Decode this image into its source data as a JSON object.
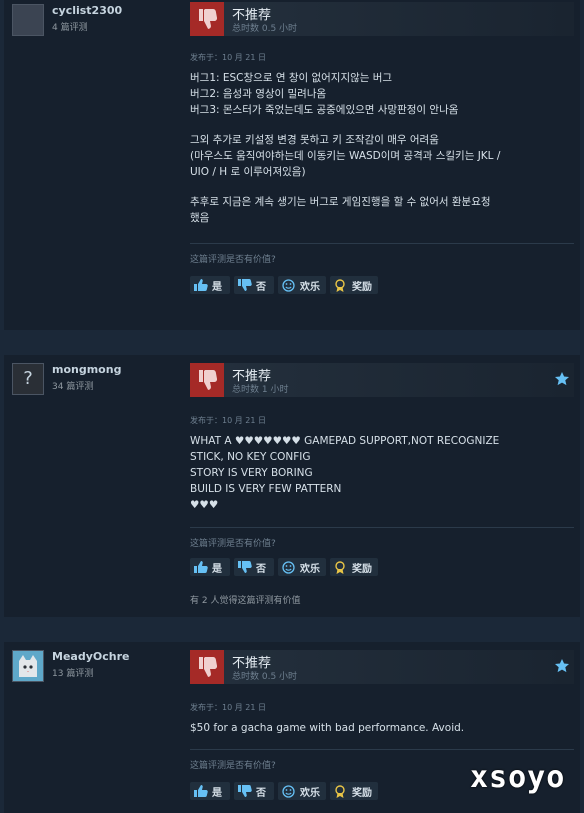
{
  "reviews": [
    {
      "author_name": "cyclist2300",
      "author_reviews": "4 篇评测",
      "avatar_icon": "user-avatar",
      "verdict": "不推荐",
      "hours": "总时数 0.5 小时",
      "posted": "发布于：10 月 21 日",
      "lines": [
        "버그1: ESC창으로 연 창이 없어지지않는 버그",
        "버그2: 음성과 영상이 밀려나옴",
        "버그3: 몬스터가 죽었는데도 공중에있으면 사망판정이 안나옴",
        "",
        "그외 추가로 키설정 변경 못하고 키 조작감이 매우 어려움",
        "(마우스도 움직여야하는데 이동키는 WASD이며 공격과 스킬키는 JKL /",
        "UIO / H 로 이루어져있음)",
        "",
        "추후로 지금은 계속 생기는 버그로 게임진행을 할 수 없어서 환분요청",
        "했음"
      ],
      "helpful_question": "这篇评测是否有价值?",
      "helpful_count": ""
    },
    {
      "author_name": "mongmong",
      "author_reviews": "34 篇评测",
      "avatar_icon": "question-mark-avatar",
      "verdict": "不推荐",
      "hours": "总时数 1 小时",
      "posted": "发布于：10 月 21 日",
      "lines": [
        "WHAT A ♥♥♥♥♥♥♥ GAMEPAD SUPPORT,NOT RECOGNIZE",
        "STICK, NO KEY CONFIG",
        "STORY IS VERY BORING",
        "BUILD IS VERY FEW PATTERN",
        "♥♥♥"
      ],
      "helpful_question": "这篇评测是否有价值?",
      "helpful_count": "有 2 人觉得这篇评测有价值"
    },
    {
      "author_name": "MeadyOchre",
      "author_reviews": "13 篇评测",
      "avatar_icon": "cat-avatar",
      "verdict": "不推荐",
      "hours": "总时数 0.5 小时",
      "posted": "发布于：10 月 21 日",
      "lines": [
        "$50 for a gacha game with bad performance. Avoid."
      ],
      "helpful_question": "这篇评测是否有价值?",
      "helpful_count": ""
    }
  ],
  "buttons": {
    "yes": "是",
    "no": "否",
    "funny": "欢乐",
    "award": "奖励"
  },
  "colors": {
    "background": "#1b2838",
    "card": "#16202d",
    "thumbs_down": "#a52a27",
    "accent": "#66c0f4"
  },
  "watermark": "xsoyo"
}
